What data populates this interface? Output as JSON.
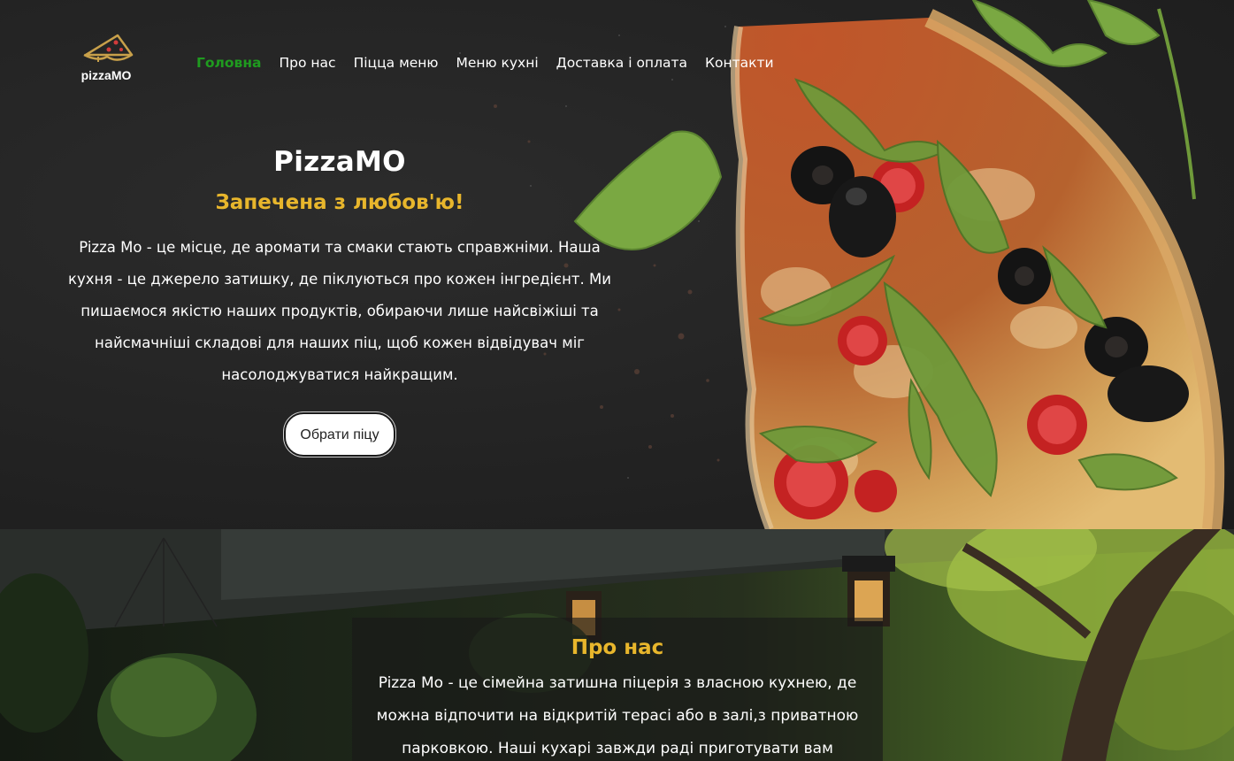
{
  "brand": {
    "logo_text": "pizzaMO"
  },
  "nav": {
    "items": [
      {
        "label": "Головна",
        "active": true
      },
      {
        "label": "Про нас",
        "active": false
      },
      {
        "label": "Піцца меню",
        "active": false
      },
      {
        "label": "Меню кухні",
        "active": false
      },
      {
        "label": "Доставка і оплата",
        "active": false
      },
      {
        "label": "Контакти",
        "active": false
      }
    ]
  },
  "hero": {
    "title": "PizzaMO",
    "subtitle": "Запечена з любов'ю!",
    "text": "Pizza Mo - це місце, де аромати та смаки стають справжніми. Наша кухня - це джерело затишку, де піклуються про кожен інгредієнт. Ми пишаємося якістю наших продуктів, обираючи лише найсвіжіші та найсмачніші складові для наших піц, щоб кожен відвідувач міг насолоджуватися найкращим.",
    "button_label": "Обрати піцу"
  },
  "about": {
    "title": "Про нас",
    "text": "Pizza Mo - це сімейна затишна піцерія з власною кухнею, де можна відпочити на відкритій терасі або в залі,з приватною парковкою. Наші кухарі завжди раді приготувати вам"
  },
  "colors": {
    "accent_gold": "#e8b62c",
    "active_nav": "#1f9b1f",
    "hero_bg": "#232323"
  }
}
